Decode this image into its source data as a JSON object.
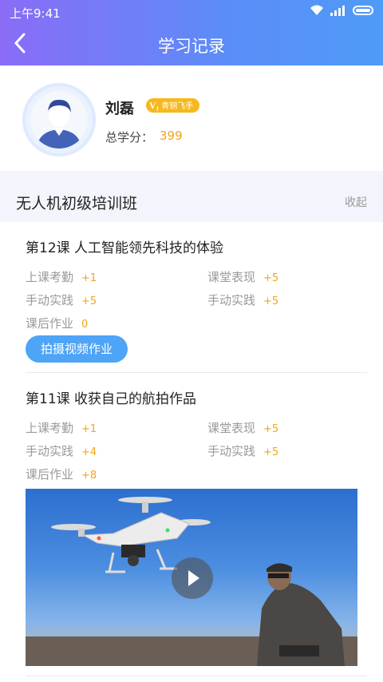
{
  "status_bar": {
    "time": "上午9:41"
  },
  "header": {
    "title": "学习记录"
  },
  "profile": {
    "name": "刘磊",
    "badge": "青铜飞手",
    "score_label": "总学分：",
    "score": "399"
  },
  "course": {
    "title": "无人机初级培训班",
    "collapse_label": "收起"
  },
  "lessons": [
    {
      "title": "第12课 人工智能领先科技的体验",
      "scores": [
        {
          "label": "上课考勤",
          "value": "+1"
        },
        {
          "label": "课堂表现",
          "value": "+5"
        },
        {
          "label": "手动实践",
          "value": "+5"
        },
        {
          "label": "手动实践",
          "value": "+5"
        },
        {
          "label": "课后作业",
          "value": "0"
        }
      ],
      "action": "拍摄视频作业"
    },
    {
      "title": "第11课  收获自己的航拍作品",
      "scores": [
        {
          "label": "上课考勤",
          "value": "+1"
        },
        {
          "label": "课堂表现",
          "value": "+5"
        },
        {
          "label": "手动实践",
          "value": "+4"
        },
        {
          "label": "手动实践",
          "value": "+5"
        },
        {
          "label": "课后作业",
          "value": "+8"
        }
      ]
    }
  ],
  "colors": {
    "accent": "#f2a51a",
    "button": "#4ea4f6",
    "header_start": "#8a6cf7",
    "header_end": "#4f9bf7"
  }
}
